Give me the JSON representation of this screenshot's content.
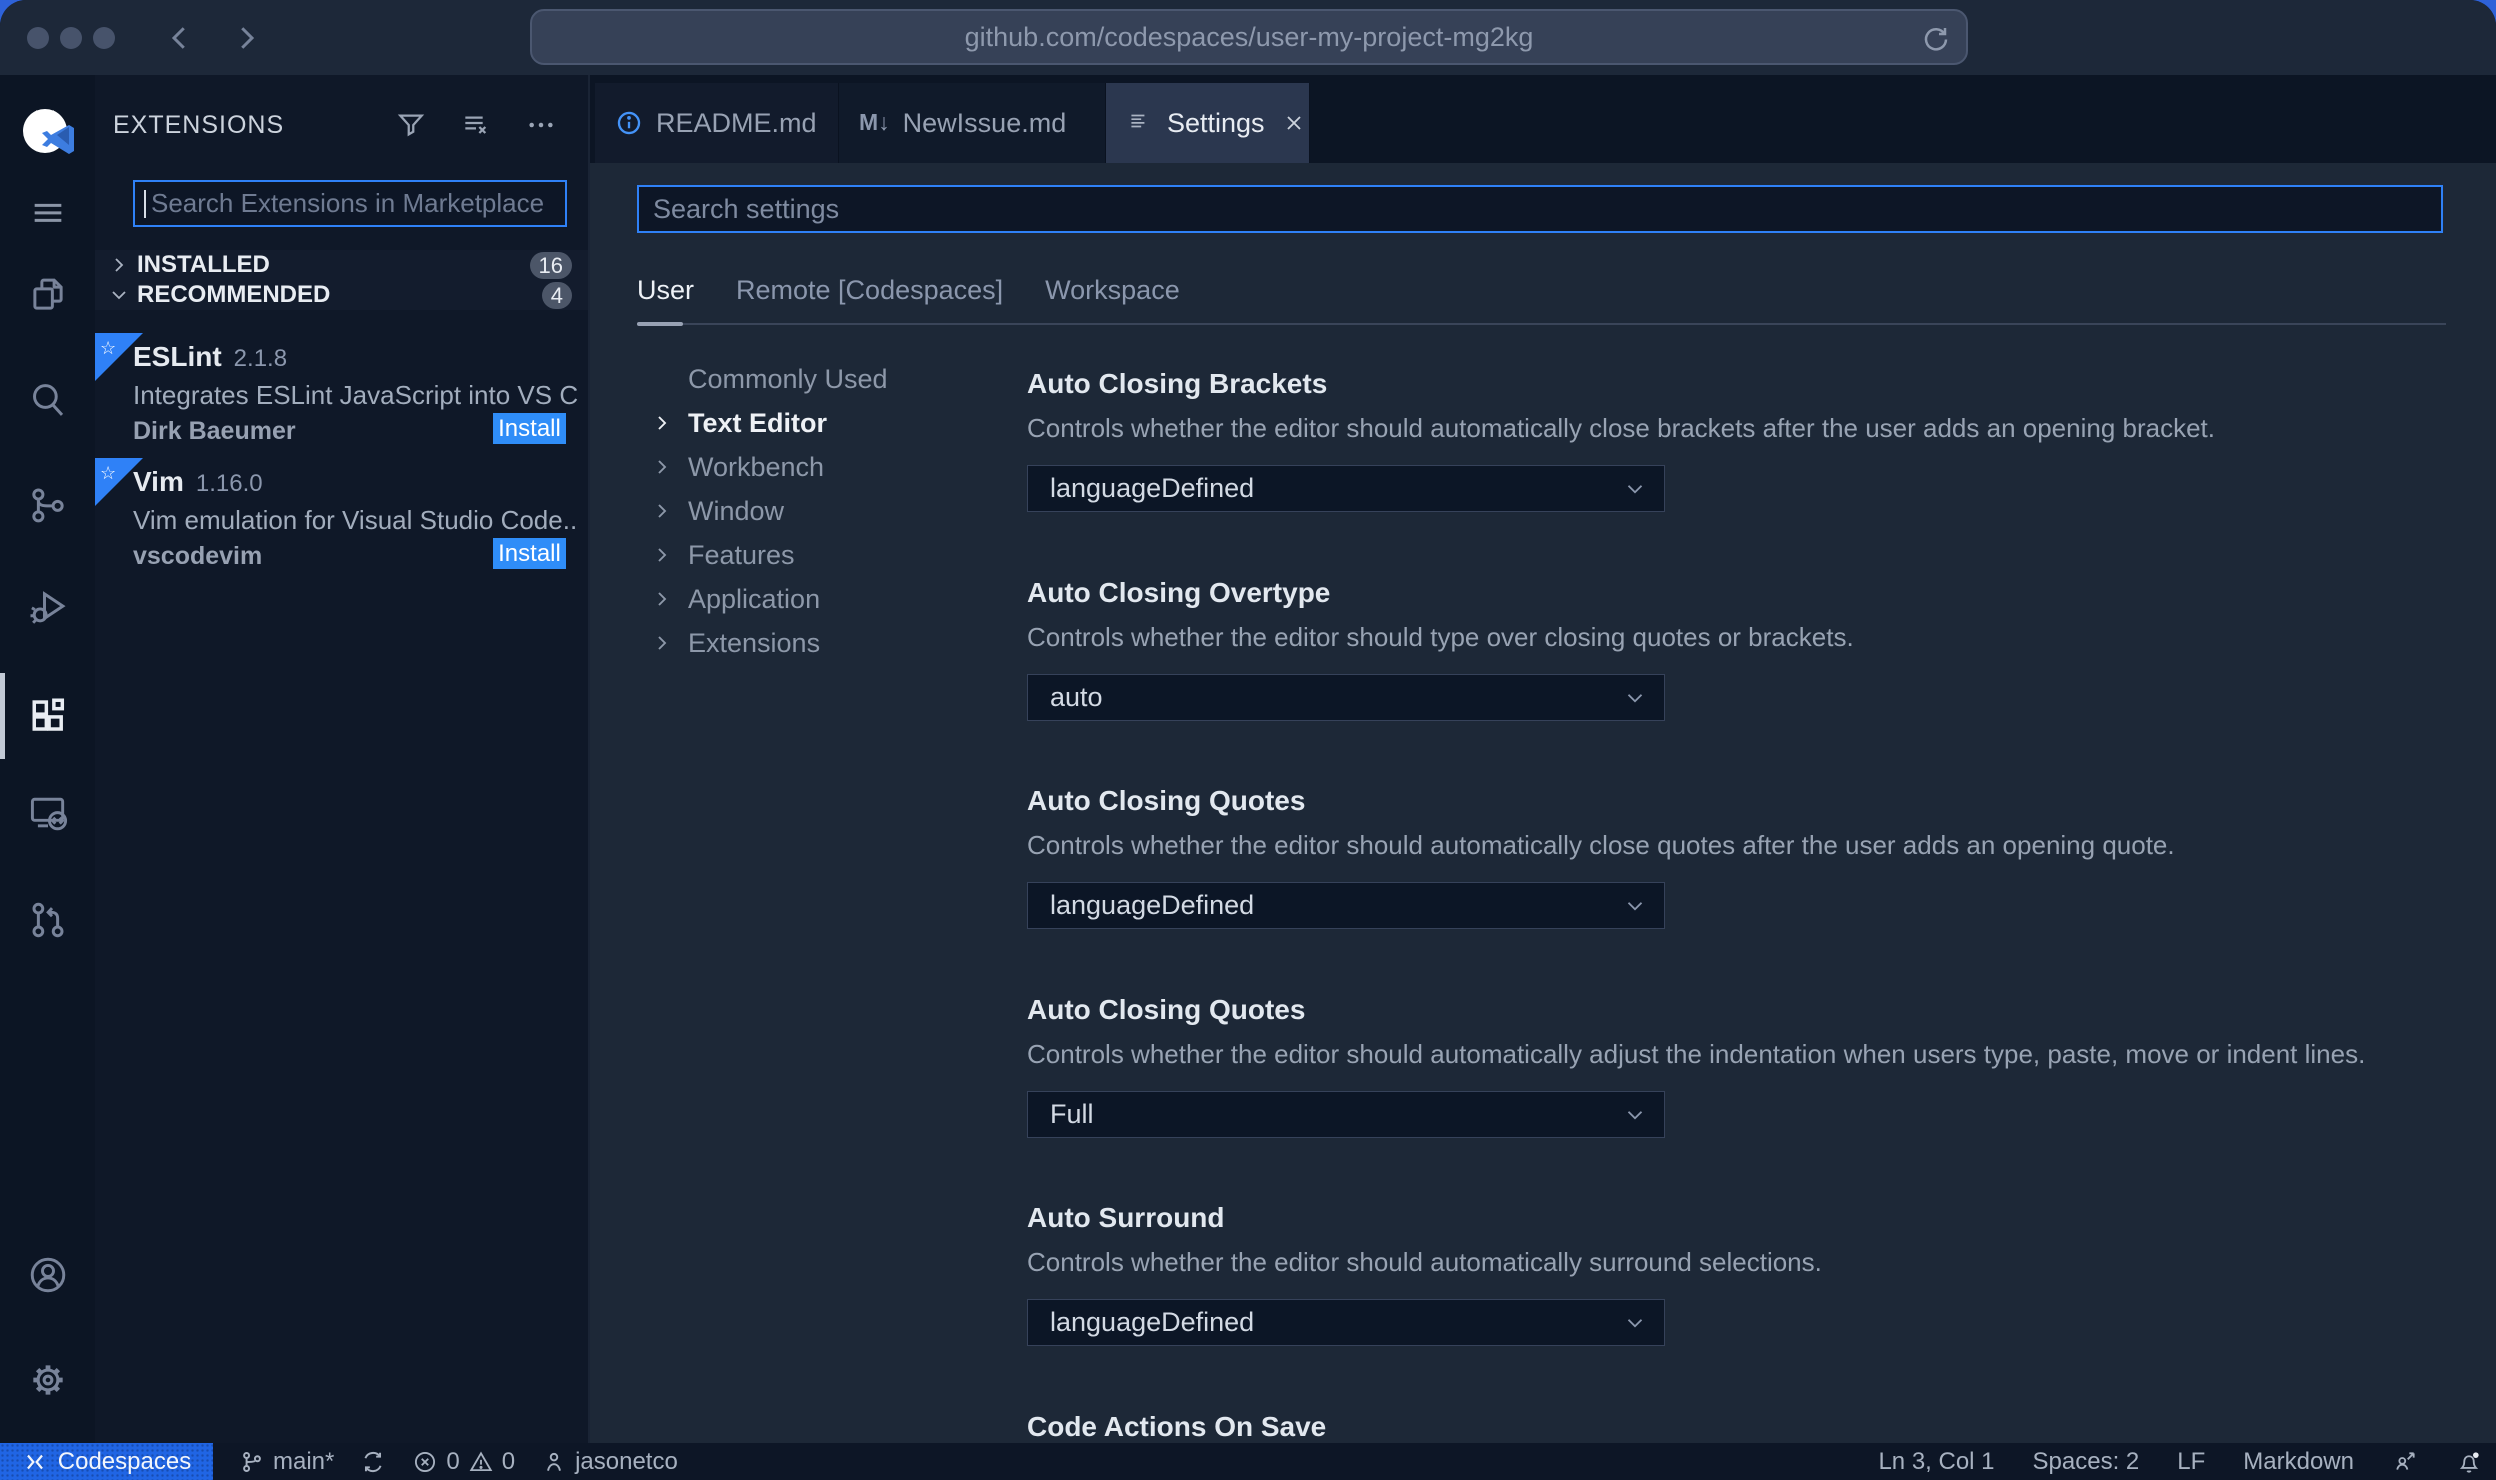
{
  "colors": {
    "focus_border_blue": "#2f81f7",
    "install_button_blue": "#2f8df8",
    "codespaces_status_blue": "#2065e4",
    "readme_tab_icon_blue": "#4493f8",
    "editor_background": "#1d2837",
    "chrome_background": "#1d2839"
  },
  "browser": {
    "url": "github.com/codespaces/user-my-project-mg2kg"
  },
  "activity_bar": {
    "icons": [
      "github-codespaces-logo",
      "menu",
      "explorer",
      "search",
      "source-control",
      "run-debug",
      "extensions (active)",
      "remote-explorer",
      "pull-requests",
      "account",
      "settings-gear"
    ]
  },
  "sidebar": {
    "title": "EXTENSIONS",
    "toolbar_icons": [
      "filter-icon",
      "clear-extensions-search-icon",
      "more-actions-icon"
    ],
    "search_placeholder": "Search Extensions in Marketplace",
    "sections": [
      {
        "label": "INSTALLED",
        "count": "16"
      },
      {
        "label": "RECOMMENDED",
        "count": "4"
      }
    ],
    "extensions": [
      {
        "name": "ESLint",
        "version": "2.1.8",
        "description": "Integrates ESLint JavaScript into VS C...",
        "publisher": "Dirk Baeumer",
        "action_label": "Install"
      },
      {
        "name": "Vim",
        "version": "1.16.0",
        "description": "Vim emulation for Visual Studio Code...",
        "publisher": "vscodevim",
        "action_label": "Install"
      }
    ]
  },
  "editor": {
    "tabs": [
      {
        "label": "README.md",
        "icon": "info-icon"
      },
      {
        "label": "NewIssue.md",
        "icon": "markdown-icon",
        "icon_glyph": "M↓"
      },
      {
        "label": "Settings",
        "icon": "settings-list-icon",
        "active": true
      }
    ],
    "settings": {
      "search_placeholder": "Search settings",
      "scopes": [
        {
          "label": "User",
          "active": true
        },
        {
          "label": "Remote [Codespaces]",
          "active": false
        },
        {
          "label": "Workspace",
          "active": false
        }
      ],
      "tree": [
        {
          "label": "Commonly Used"
        },
        {
          "label": "Text Editor",
          "selected": true
        },
        {
          "label": "Workbench"
        },
        {
          "label": "Window"
        },
        {
          "label": "Features"
        },
        {
          "label": "Application"
        },
        {
          "label": "Extensions"
        }
      ],
      "items": [
        {
          "title": "Auto Closing Brackets",
          "description": "Controls whether the editor should automatically close brackets after the user adds an opening bracket.",
          "value": "languageDefined"
        },
        {
          "title": "Auto Closing Overtype",
          "description": "Controls whether the editor should type over closing quotes or brackets.",
          "value": "auto"
        },
        {
          "title": "Auto Closing Quotes",
          "description": "Controls whether the editor should automatically close quotes after the user adds an opening quote.",
          "value": "languageDefined"
        },
        {
          "title": "Auto Closing Quotes",
          "description": "Controls whether the editor should automatically adjust the indentation when users type, paste, move or indent lines.",
          "value": "Full"
        },
        {
          "title": "Auto Surround",
          "description": "Controls whether the editor should automatically surround selections.",
          "value": "languageDefined"
        },
        {
          "title": "Code Actions On Save"
        }
      ]
    }
  },
  "status_bar": {
    "codespaces_label": "Codespaces",
    "branch": "main*",
    "errors": "0",
    "warnings": "0",
    "user": "jasonetco",
    "cursor_position": "Ln 3, Col 1",
    "indentation": "Spaces: 2",
    "eol": "LF",
    "language": "Markdown"
  }
}
